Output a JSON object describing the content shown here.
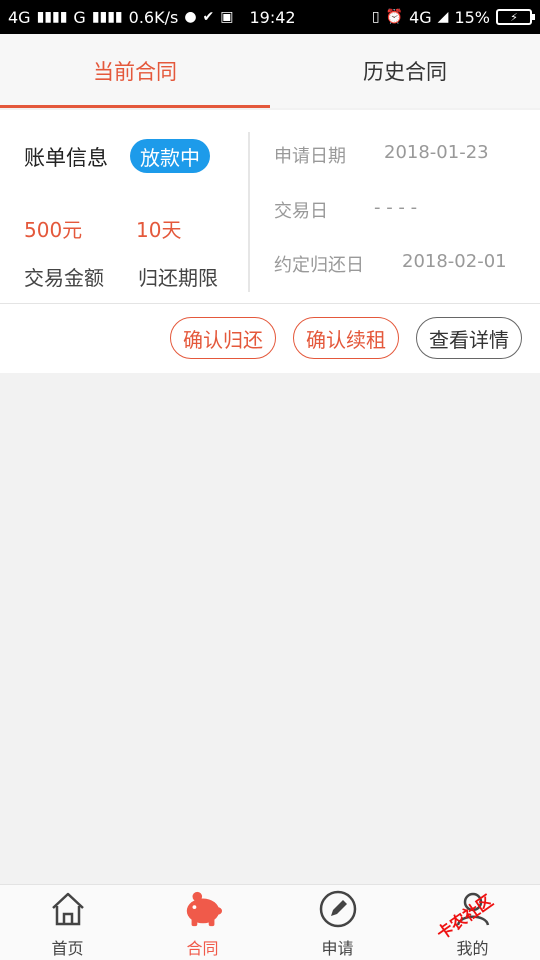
{
  "status_bar": {
    "left": "4G",
    "signal2": "G",
    "net_speed": "0.6K/s",
    "time": "19:42",
    "network_right": "4G",
    "battery": "15%"
  },
  "tabs": [
    {
      "label": "当前合同",
      "active": true
    },
    {
      "label": "历史合同",
      "active": false
    }
  ],
  "contract": {
    "bill_title": "账单信息",
    "status": "放款中",
    "amount_value": "500元",
    "term_value": "10天",
    "amount_label": "交易金额",
    "term_label": "归还期限",
    "apply_date_label": "申请日期",
    "apply_date": "2018-01-23",
    "trade_date_label": "交易日",
    "trade_date": "- - - -",
    "due_date_label": "约定归还日",
    "due_date": "2018-02-01"
  },
  "actions": {
    "confirm_return": "确认归还",
    "confirm_renew": "确认续租",
    "view_details": "查看详情"
  },
  "bottom_nav": [
    {
      "label": "首页",
      "icon": "home-icon"
    },
    {
      "label": "合同",
      "icon": "piggy-bank-icon",
      "active": true
    },
    {
      "label": "申请",
      "icon": "pencil-icon"
    },
    {
      "label": "我的",
      "icon": "user-icon"
    }
  ],
  "watermark": "卡农社区",
  "colors": {
    "accent": "#e4583b",
    "badge": "#1d9bea",
    "nav_active": "#f05a4a"
  }
}
